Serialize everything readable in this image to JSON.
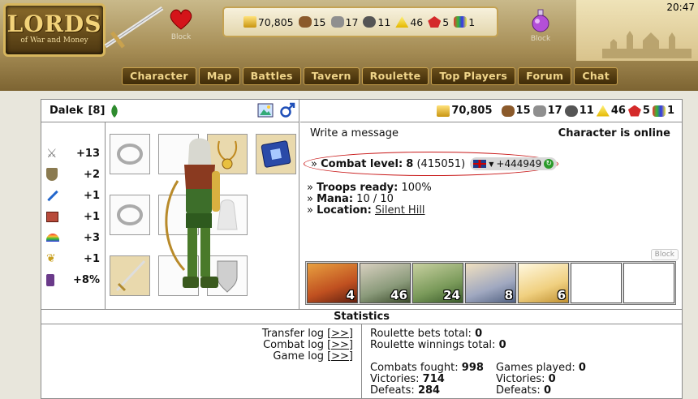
{
  "header": {
    "logo_title": "LORDS",
    "logo_subtitle": "of War and Money",
    "left_block_label": "Block",
    "right_block_label": "Block",
    "clock": "20:47",
    "resources": [
      {
        "icon": "gold-icon",
        "value": "70,805"
      },
      {
        "icon": "wood-icon",
        "value": "15"
      },
      {
        "icon": "stone-icon",
        "value": "17"
      },
      {
        "icon": "iron-icon",
        "value": "11"
      },
      {
        "icon": "sulfur-icon",
        "value": "46"
      },
      {
        "icon": "crystal-icon",
        "value": "5"
      },
      {
        "icon": "gems-icon",
        "value": "1"
      }
    ]
  },
  "nav": [
    "Character",
    "Map",
    "Battles",
    "Tavern",
    "Roulette",
    "Top Players",
    "Forum",
    "Chat"
  ],
  "character": {
    "name": "Dalek",
    "level": "[8]",
    "stats": [
      {
        "icon": "attack-swords-icon",
        "value": "+13"
      },
      {
        "icon": "defense-shield-icon",
        "value": "+2"
      },
      {
        "icon": "magic-wand-icon",
        "value": "+1"
      },
      {
        "icon": "knowledge-book-icon",
        "value": "+1"
      },
      {
        "icon": "luck-rainbow-icon",
        "value": "+3"
      },
      {
        "icon": "morale-wings-icon",
        "value": "+1"
      },
      {
        "icon": "bonus-scroll-icon",
        "value": "+8%"
      }
    ]
  },
  "panel": {
    "resources": [
      {
        "icon": "gold-icon",
        "value": "70,805"
      },
      {
        "icon": "wood-icon",
        "value": "15"
      },
      {
        "icon": "stone-icon",
        "value": "17"
      },
      {
        "icon": "iron-icon",
        "value": "11"
      },
      {
        "icon": "sulfur-icon",
        "value": "46"
      },
      {
        "icon": "crystal-icon",
        "value": "5"
      },
      {
        "icon": "gems-icon",
        "value": "1"
      }
    ],
    "write_message": "Write a message",
    "online_status": "Character is online",
    "combat_label": "Combat level:",
    "combat_level": "8",
    "combat_exp": "(415051)",
    "rating": "+444949",
    "troops_label": "Troops ready:",
    "troops_value": "100%",
    "mana_label": "Mana:",
    "mana_value": "10 / 10",
    "location_label": "Location:",
    "location_value": "Silent Hill",
    "block_label": "Block",
    "troops": [
      {
        "name": "elf-ranger",
        "count": "4"
      },
      {
        "name": "elf-archer",
        "count": "46"
      },
      {
        "name": "elf-druid",
        "count": "24"
      },
      {
        "name": "elf-mage",
        "count": "8"
      },
      {
        "name": "unicorn",
        "count": "6"
      },
      {
        "name": "empty",
        "count": ""
      },
      {
        "name": "empty",
        "count": ""
      }
    ]
  },
  "statistics": {
    "title": "Statistics",
    "logs": [
      {
        "label": "Transfer log",
        "link": "[>>]"
      },
      {
        "label": "Combat log",
        "link": "[>>]"
      },
      {
        "label": "Game log",
        "link": "[>>]"
      }
    ],
    "roulette_bets_label": "Roulette bets total:",
    "roulette_bets_value": "0",
    "roulette_win_label": "Roulette winnings total:",
    "roulette_win_value": "0",
    "combats_label": "Combats fought:",
    "combats_value": "998",
    "victories_label": "Victories:",
    "victories_value": "714",
    "defeats_label": "Defeats:",
    "defeats_value": "284",
    "games_label": "Games played:",
    "games_value": "0",
    "g_victories_label": "Victories:",
    "g_victories_value": "0",
    "g_defeats_label": "Defeats:",
    "g_defeats_value": "0"
  }
}
